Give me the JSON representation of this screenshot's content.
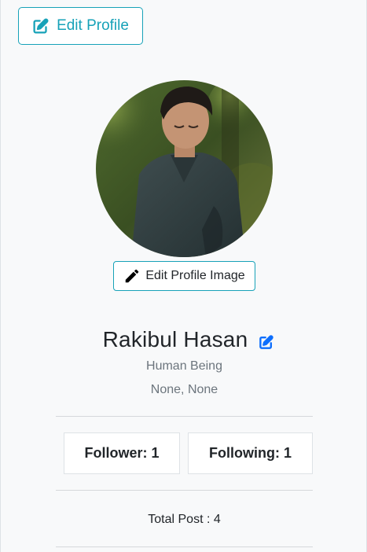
{
  "profile_edit": {
    "label": "Edit Profile",
    "icon": "edit-square-icon",
    "color": "#17a2b8"
  },
  "avatar": {
    "icon": "profile-photo"
  },
  "image_edit": {
    "label": "Edit Profile Image",
    "icon": "pencil-icon"
  },
  "user": {
    "name": "Rakibul Hasan",
    "name_edit_icon": "edit-square-icon",
    "name_edit_color": "#0d6efd",
    "bio": "Human Being",
    "location": "None, None"
  },
  "stats": {
    "follower_label": "Follower: 1",
    "following_label": "Following: 1",
    "total_post_label": "Total Post : 4"
  }
}
